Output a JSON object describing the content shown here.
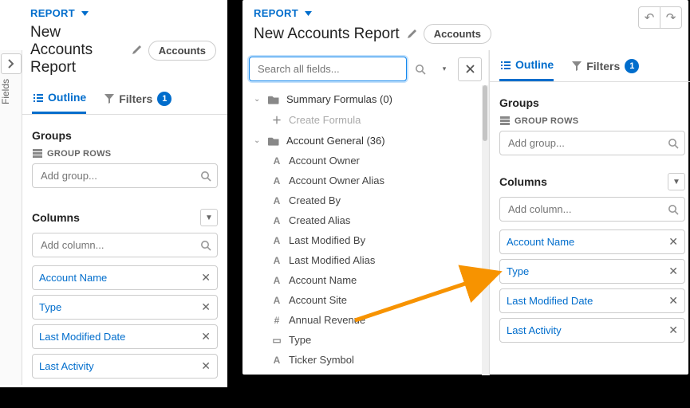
{
  "header": {
    "report_label": "REPORT",
    "title": "New Accounts Report",
    "badge": "Accounts"
  },
  "left_tab_label": "Fields",
  "tabs": {
    "outline": "Outline",
    "filters": "Filters",
    "filter_count": "1"
  },
  "groups": {
    "heading": "Groups",
    "sub": "GROUP ROWS",
    "placeholder": "Add group..."
  },
  "columns": {
    "heading": "Columns",
    "placeholder": "Add column...",
    "items": [
      "Account Name",
      "Type",
      "Last Modified Date",
      "Last Activity"
    ]
  },
  "search": {
    "placeholder": "Search all fields..."
  },
  "tree": {
    "summary": "Summary Formulas (0)",
    "create": "Create Formula",
    "acct_general": "Account General (36)",
    "fields": [
      {
        "icon": "A",
        "label": "Account Owner"
      },
      {
        "icon": "A",
        "label": "Account Owner Alias"
      },
      {
        "icon": "A",
        "label": "Created By"
      },
      {
        "icon": "A",
        "label": "Created Alias"
      },
      {
        "icon": "A",
        "label": "Last Modified By"
      },
      {
        "icon": "A",
        "label": "Last Modified Alias"
      },
      {
        "icon": "A",
        "label": "Account Name"
      },
      {
        "icon": "A",
        "label": "Account Site"
      },
      {
        "icon": "#",
        "label": "Annual Revenue"
      },
      {
        "icon": "▭",
        "label": "Type"
      },
      {
        "icon": "A",
        "label": "Ticker Symbol"
      }
    ]
  }
}
